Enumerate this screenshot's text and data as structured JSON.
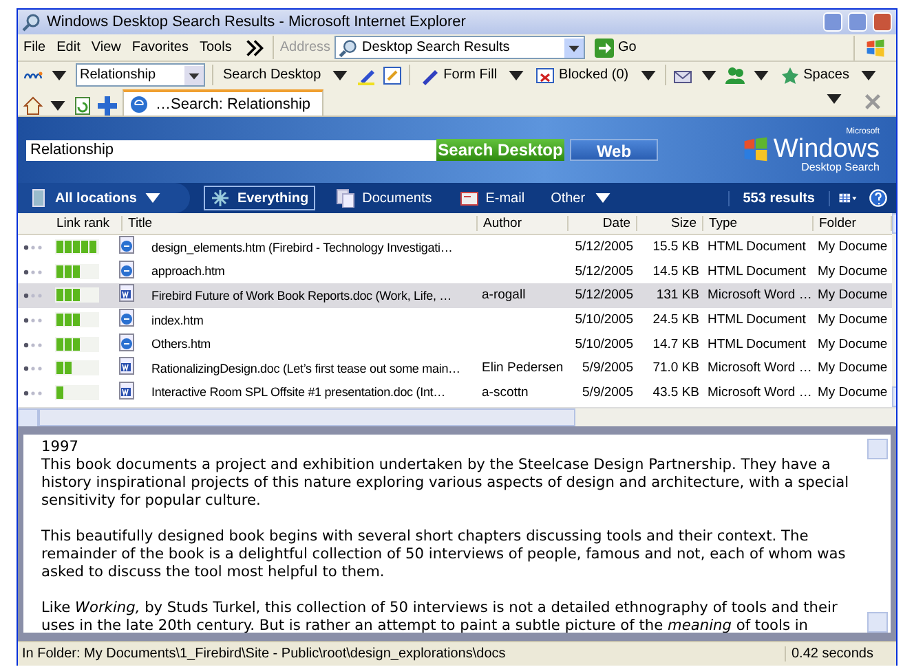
{
  "window": {
    "title": "Windows Desktop Search Results - Microsoft Internet Explorer"
  },
  "menu": [
    "File",
    "Edit",
    "View",
    "Favorites",
    "Tools"
  ],
  "address": {
    "label": "Address",
    "value": "Desktop Search Results",
    "go": "Go"
  },
  "msn_toolbar": {
    "query": "Relationship",
    "search": "Search Desktop",
    "form_fill": "Form Fill",
    "blocked": "Blocked (0)",
    "spaces": "Spaces"
  },
  "tab": {
    "title": "…Search: Relationship"
  },
  "search": {
    "value": "Relationship",
    "search_button": "Search Desktop",
    "web_button": "Web",
    "logo_small": "Microsoft",
    "logo_big": "Windows",
    "logo_sub": "Desktop Search"
  },
  "filters": {
    "location": "All locations",
    "types": [
      {
        "label": "Everything",
        "selected": true,
        "kind": "all"
      },
      {
        "label": "Documents",
        "selected": false,
        "kind": "documents"
      },
      {
        "label": "E-mail",
        "selected": false,
        "kind": "email"
      }
    ],
    "other": "Other",
    "count": "553 results"
  },
  "table": {
    "columns": [
      "Link rank",
      "Title",
      "Author",
      "Date",
      "Size",
      "Type",
      "Folder"
    ],
    "rows": [
      {
        "level": 1,
        "kind": "html",
        "title": "design_elements.htm (Firebird - Technology Investigati…",
        "author": "",
        "date": "5/12/2005",
        "size": "15.5 KB",
        "type": "HTML Document",
        "folder": "My Docume",
        "selected": false
      },
      {
        "level": 0.6,
        "kind": "html",
        "title": "approach.htm",
        "author": "",
        "date": "5/12/2005",
        "size": "14.5 KB",
        "type": "HTML Document",
        "folder": "My Docume",
        "selected": false
      },
      {
        "level": 0.6,
        "kind": "word",
        "title": "Firebird Future of Work Book Reports.doc (Work, Life, …",
        "author": "a-rogall",
        "date": "5/12/2005",
        "size": "131 KB",
        "type": "Microsoft Word …",
        "folder": "My Docume",
        "selected": true
      },
      {
        "level": 0.6,
        "kind": "html",
        "title": "index.htm",
        "author": "",
        "date": "5/10/2005",
        "size": "24.5 KB",
        "type": "HTML Document",
        "folder": "My Docume",
        "selected": false
      },
      {
        "level": 0.6,
        "kind": "html",
        "title": "Others.htm",
        "author": "",
        "date": "5/10/2005",
        "size": "14.7 KB",
        "type": "HTML Document",
        "folder": "My Docume",
        "selected": false
      },
      {
        "level": 0.4,
        "kind": "word",
        "title": "RationalizingDesign.doc (Let’s first tease out some main…",
        "author": "Elin Pedersen",
        "date": "5/9/2005",
        "size": "71.0 KB",
        "type": "Microsoft Word …",
        "folder": "My Docume",
        "selected": false
      },
      {
        "level": 0.2,
        "kind": "word",
        "title": "Interactive Room SPL Offsite #1 presentation.doc (Int…",
        "author": "a-scottn",
        "date": "5/9/2005",
        "size": "43.5 KB",
        "type": "Microsoft Word …",
        "folder": "My Docume",
        "selected": false
      }
    ]
  },
  "preview": {
    "paragraphs": [
      "1997",
      "This book documents a project and exhibition undertaken by the Steelcase Design Partnership. They have a history inspirational projects of this nature exploring various aspects of design and architecture, with a special sensitivity for popular culture.",
      "This beautifully designed book begins with several short chapters discussing tools and their context. The remainder of the book is a delightful collection of 50 interviews of people, famous and not, each of whom was asked to discuss the tool most helpful to them.",
      "Like *Working,* by Studs Turkel, this collection of 50 interviews is not a detailed ethnography of tools and their uses in the late 20th century. But is rather an attempt to paint a subtle picture of the *meaning* of tools in"
    ]
  },
  "status_bar": {
    "folder": "In Folder:  My Documents\\1_Firebird\\Site - Public\\root\\design_explorations\\docs",
    "time": "0.42 seconds"
  }
}
